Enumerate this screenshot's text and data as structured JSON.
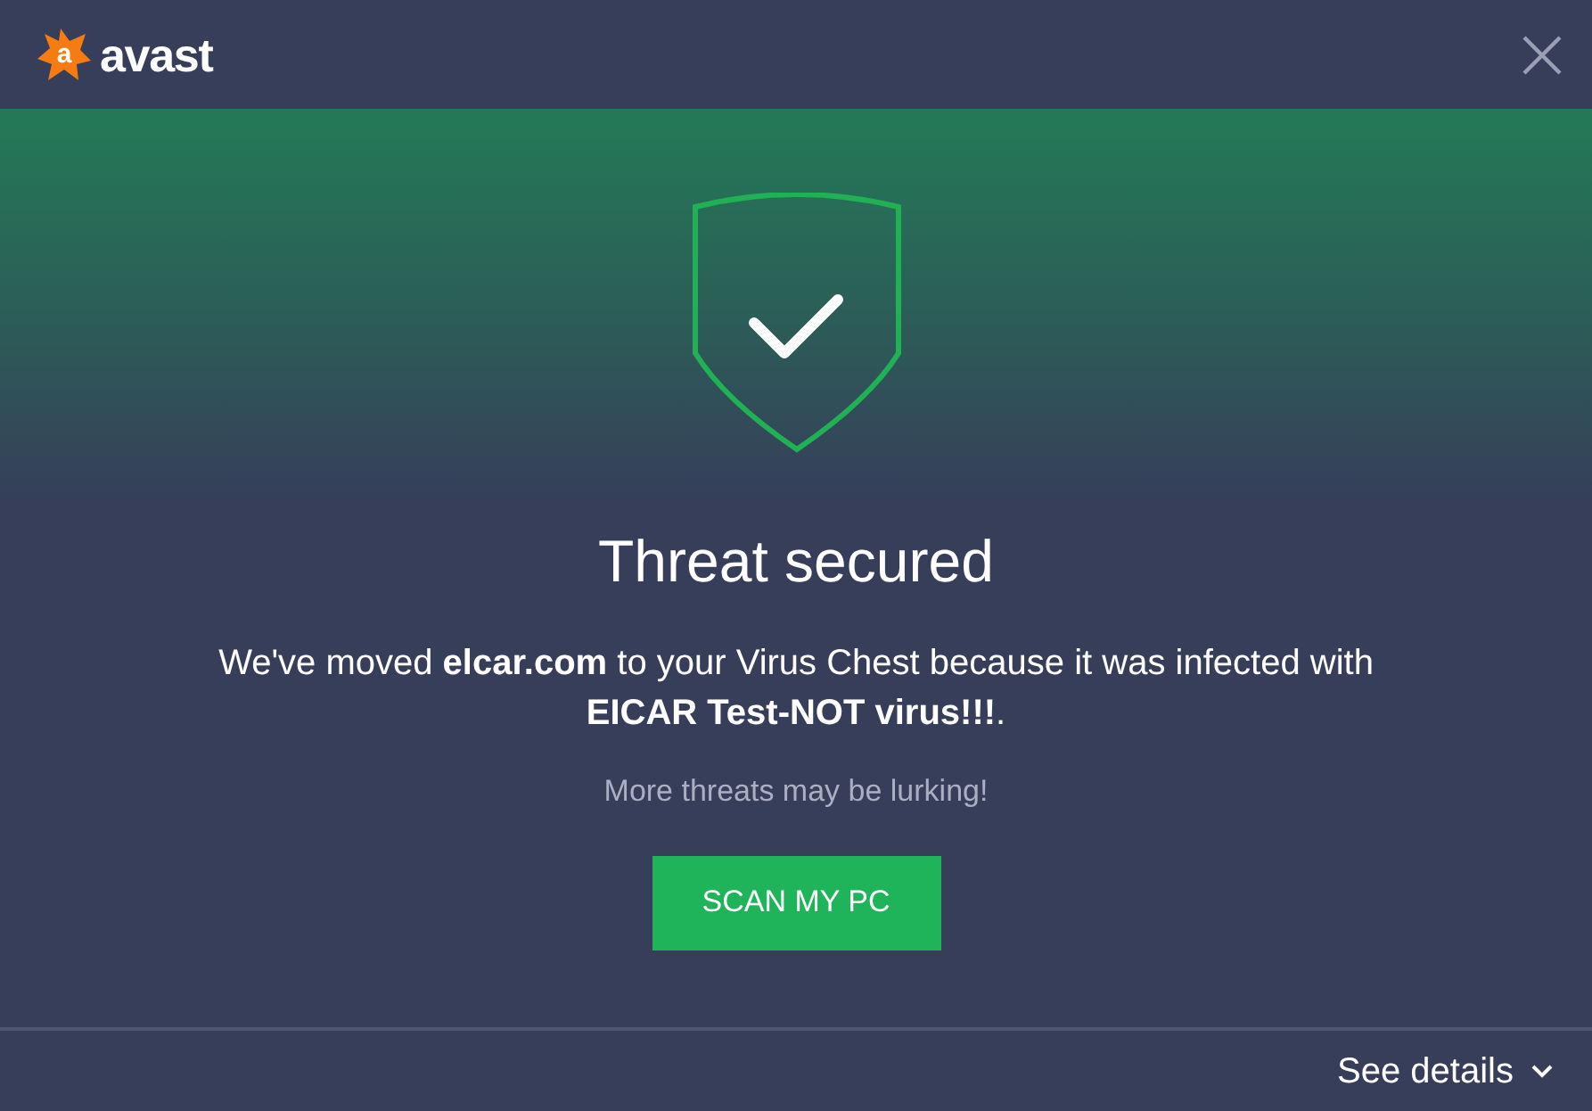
{
  "logo": {
    "mark": "a",
    "name": "avast"
  },
  "title": "Threat secured",
  "message": [
    "We've moved **elcar.com** to your Virus Chest because it was infected with",
    "**EICAR Test-NOT virus!!!**."
  ],
  "hint": "More threats may be lurking!",
  "button": "SCAN MY PC",
  "details": "See details"
}
